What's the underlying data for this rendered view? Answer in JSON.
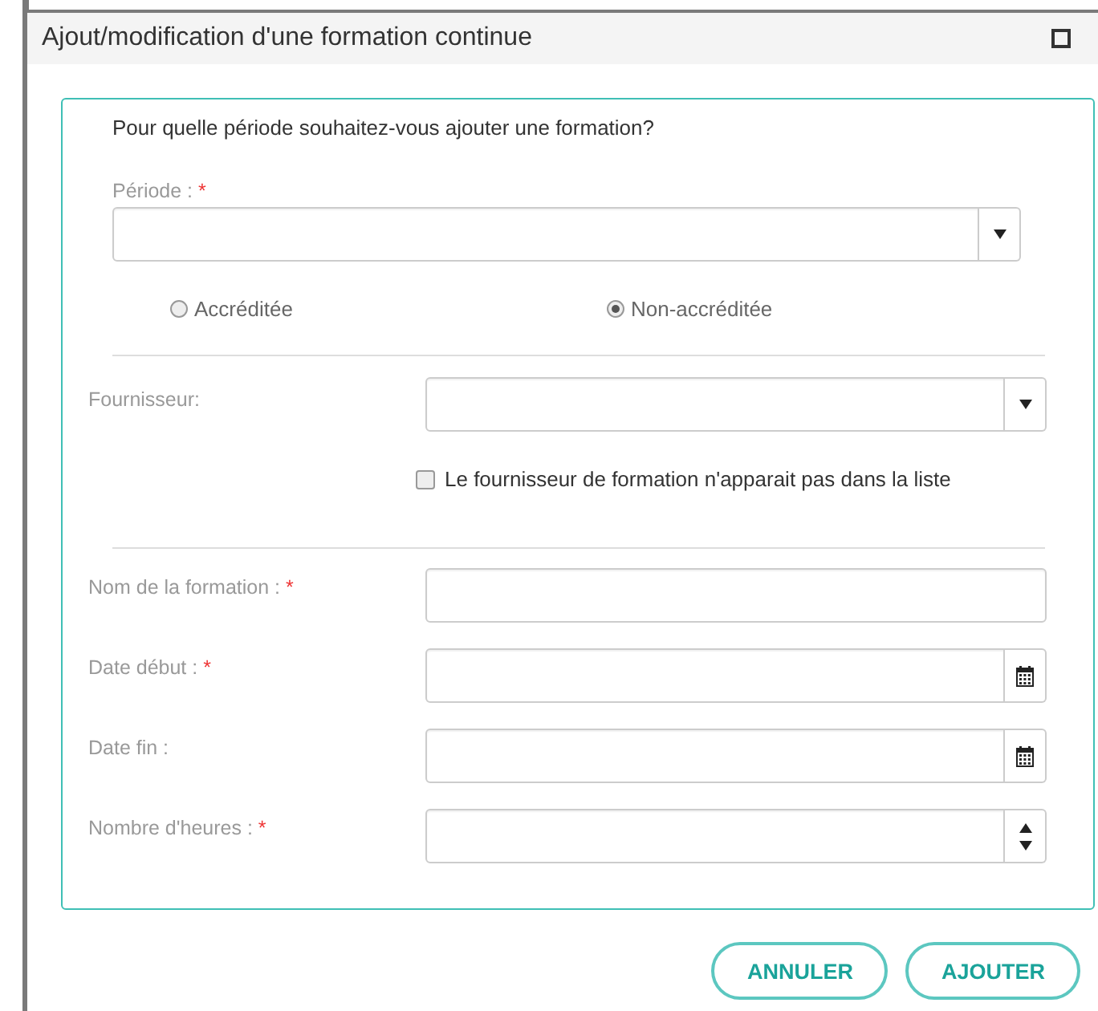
{
  "window": {
    "title": "Ajout/modification d'une formation continue"
  },
  "question": "Pour quelle période souhaitez-vous ajouter une formation?",
  "period": {
    "label": "Période :",
    "marker": "*",
    "kind": "select"
  },
  "options": [
    {
      "label": "Accréditée",
      "selected": false
    },
    {
      "label": "Non-accréditée",
      "selected": true
    }
  ],
  "supplier": {
    "label": "Fournisseur:",
    "kind": "select"
  },
  "not_listed": {
    "label": "Le fournisseur de formation n'apparait pas dans la liste",
    "checked": false
  },
  "fields": [
    {
      "label": "Nom de la formation :",
      "marker": "*",
      "kind": "text"
    },
    {
      "label": "Date début :",
      "marker": "*",
      "kind": "date"
    },
    {
      "label": "Date fin :",
      "kind": "date"
    },
    {
      "label": "Nombre d'heures :",
      "marker": "*",
      "kind": "number"
    }
  ],
  "buttons": [
    "ANNULER",
    "AJOUTER"
  ]
}
